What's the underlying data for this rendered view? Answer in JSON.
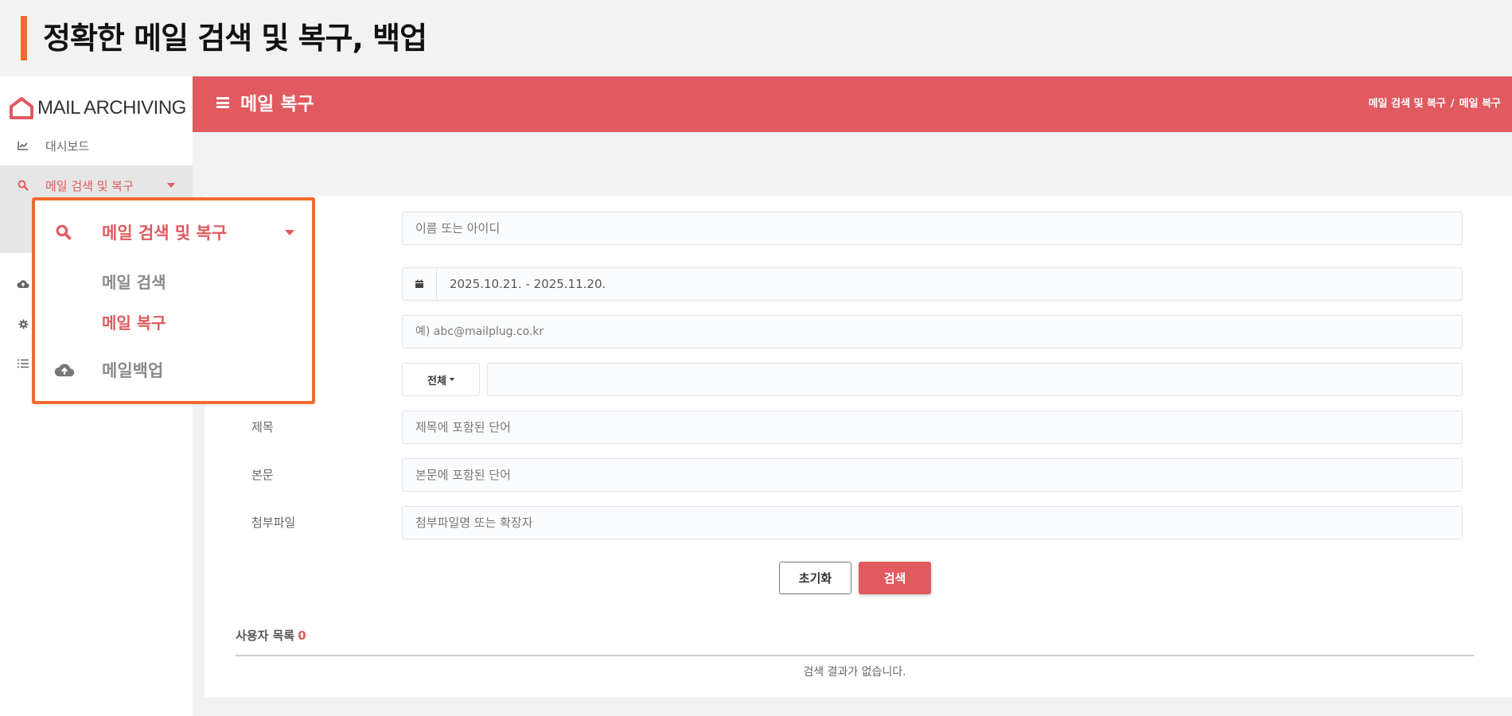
{
  "slide": {
    "title": "정확한 메일 검색 및 복구, 백업",
    "accent_color": "#f26a2e"
  },
  "brand": {
    "logo_text": "MAIL ARCHIVING",
    "logo_icon": "house-icon",
    "color": "#e05a5f"
  },
  "sidebar": {
    "items": [
      {
        "label": "대시보드",
        "icon": "chart-line-icon"
      },
      {
        "label": "메일 검색 및 복구",
        "icon": "search-icon",
        "active": true
      },
      {
        "label": "",
        "icon": "cloud-upload-icon"
      },
      {
        "label": "",
        "icon": "gear-icon"
      },
      {
        "label": "",
        "icon": "list-icon"
      }
    ]
  },
  "topbar": {
    "menu_icon": "hamburger-icon",
    "title": "메일 복구",
    "breadcrumb": [
      "메일 검색 및 복구",
      "메일 복구"
    ],
    "breadcrumb_sep": "/"
  },
  "form": {
    "user_placeholder": "이름 또는 아이디",
    "date_icon": "calendar-icon",
    "date_value": "2025.10.21. - 2025.11.20.",
    "email_placeholder": "예) abc@mailplug.co.kr",
    "scope_select": "전체",
    "subject_label": "제목",
    "subject_placeholder": "제목에 포함된 단어",
    "body_label": "본문",
    "body_placeholder": "본문에 포함된 단어",
    "attachment_label": "첨부파일",
    "attachment_placeholder": "첨부파일명 또는 확장자",
    "reset_label": "초기화",
    "search_label": "검색"
  },
  "results": {
    "title": "사용자 목록",
    "count": "0",
    "empty_message": "검색 결과가 없습니다."
  },
  "highlight_menu": {
    "parent_label": "메일 검색 및 복구",
    "parent_icon": "search-icon",
    "sub_items": [
      {
        "label": "메일 검색",
        "active": false
      },
      {
        "label": "메일 복구",
        "active": true
      }
    ],
    "backup_label": "메일백업",
    "backup_icon": "cloud-upload-icon"
  }
}
